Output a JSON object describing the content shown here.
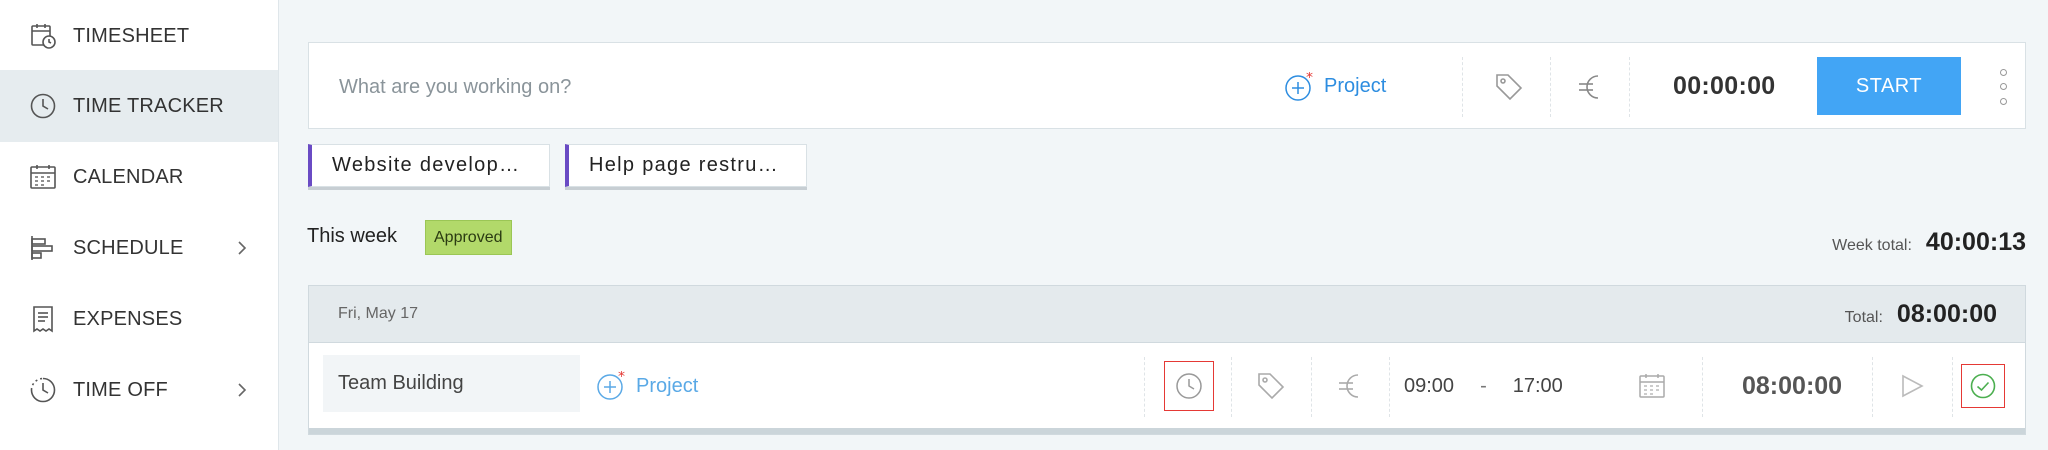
{
  "sidebar": {
    "items": [
      {
        "label": "TIMESHEET",
        "icon": "timesheet-icon",
        "active": false,
        "has_submenu": false
      },
      {
        "label": "TIME TRACKER",
        "icon": "clock-icon",
        "active": true,
        "has_submenu": false
      },
      {
        "label": "CALENDAR",
        "icon": "calendar-icon",
        "active": false,
        "has_submenu": false
      },
      {
        "label": "SCHEDULE",
        "icon": "schedule-icon",
        "active": false,
        "has_submenu": true
      },
      {
        "label": "EXPENSES",
        "icon": "receipt-icon",
        "active": false,
        "has_submenu": false
      },
      {
        "label": "TIME OFF",
        "icon": "time-off-icon",
        "active": false,
        "has_submenu": true
      }
    ]
  },
  "tracker": {
    "description_placeholder": "What are you working on?",
    "project_label": "Project",
    "timer": "00:00:00",
    "start_label": "START"
  },
  "recent_entries": [
    {
      "label": "Website develop…",
      "accent": "#6a4bc4"
    },
    {
      "label": "Help page restru…",
      "accent": "#6a4bc4"
    }
  ],
  "week": {
    "label": "This week",
    "status_badge": "Approved",
    "total_label": "Week total:",
    "total_value": "40:00:13"
  },
  "day": {
    "date": "Fri, May 17",
    "total_label": "Total:",
    "total_value": "08:00:00",
    "entry": {
      "description": "Team Building",
      "project_label": "Project",
      "start_time": "09:00",
      "separator": "-",
      "end_time": "17:00",
      "duration": "08:00:00"
    }
  },
  "colors": {
    "accent_blue": "#42a5f5",
    "project_link": "#2d8de0",
    "approved_badge": "#b2d96a",
    "highlight_red": "#e53935",
    "approved_check": "#4caf50"
  }
}
